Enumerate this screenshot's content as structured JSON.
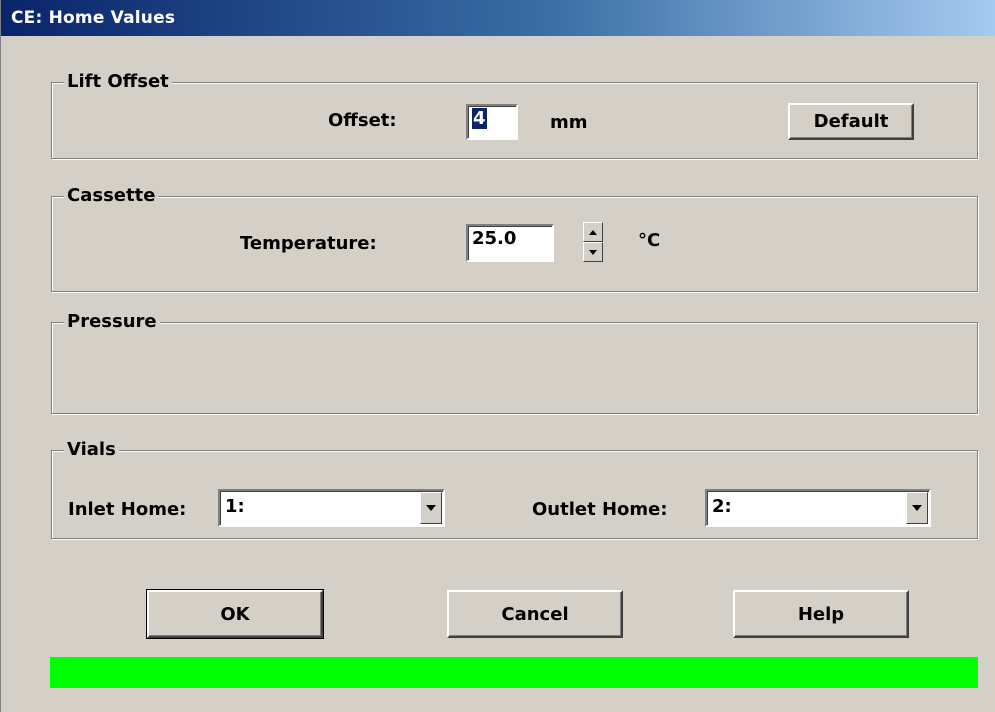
{
  "window": {
    "title": "CE: Home Values"
  },
  "lift_offset": {
    "group_label": "Lift Offset",
    "offset_label": "Offset:",
    "offset_value": "4",
    "unit": "mm",
    "default_button": "Default"
  },
  "cassette": {
    "group_label": "Cassette",
    "temperature_label": "Temperature:",
    "temperature_value": "25.0",
    "unit": "°C"
  },
  "pressure": {
    "group_label": "Pressure"
  },
  "vials": {
    "group_label": "Vials",
    "inlet_label": "Inlet Home:",
    "inlet_value": "1:",
    "outlet_label": "Outlet Home:",
    "outlet_value": "2:"
  },
  "buttons": {
    "ok": "OK",
    "cancel": "Cancel",
    "help": "Help"
  },
  "status": {
    "color": "#00ff00"
  }
}
